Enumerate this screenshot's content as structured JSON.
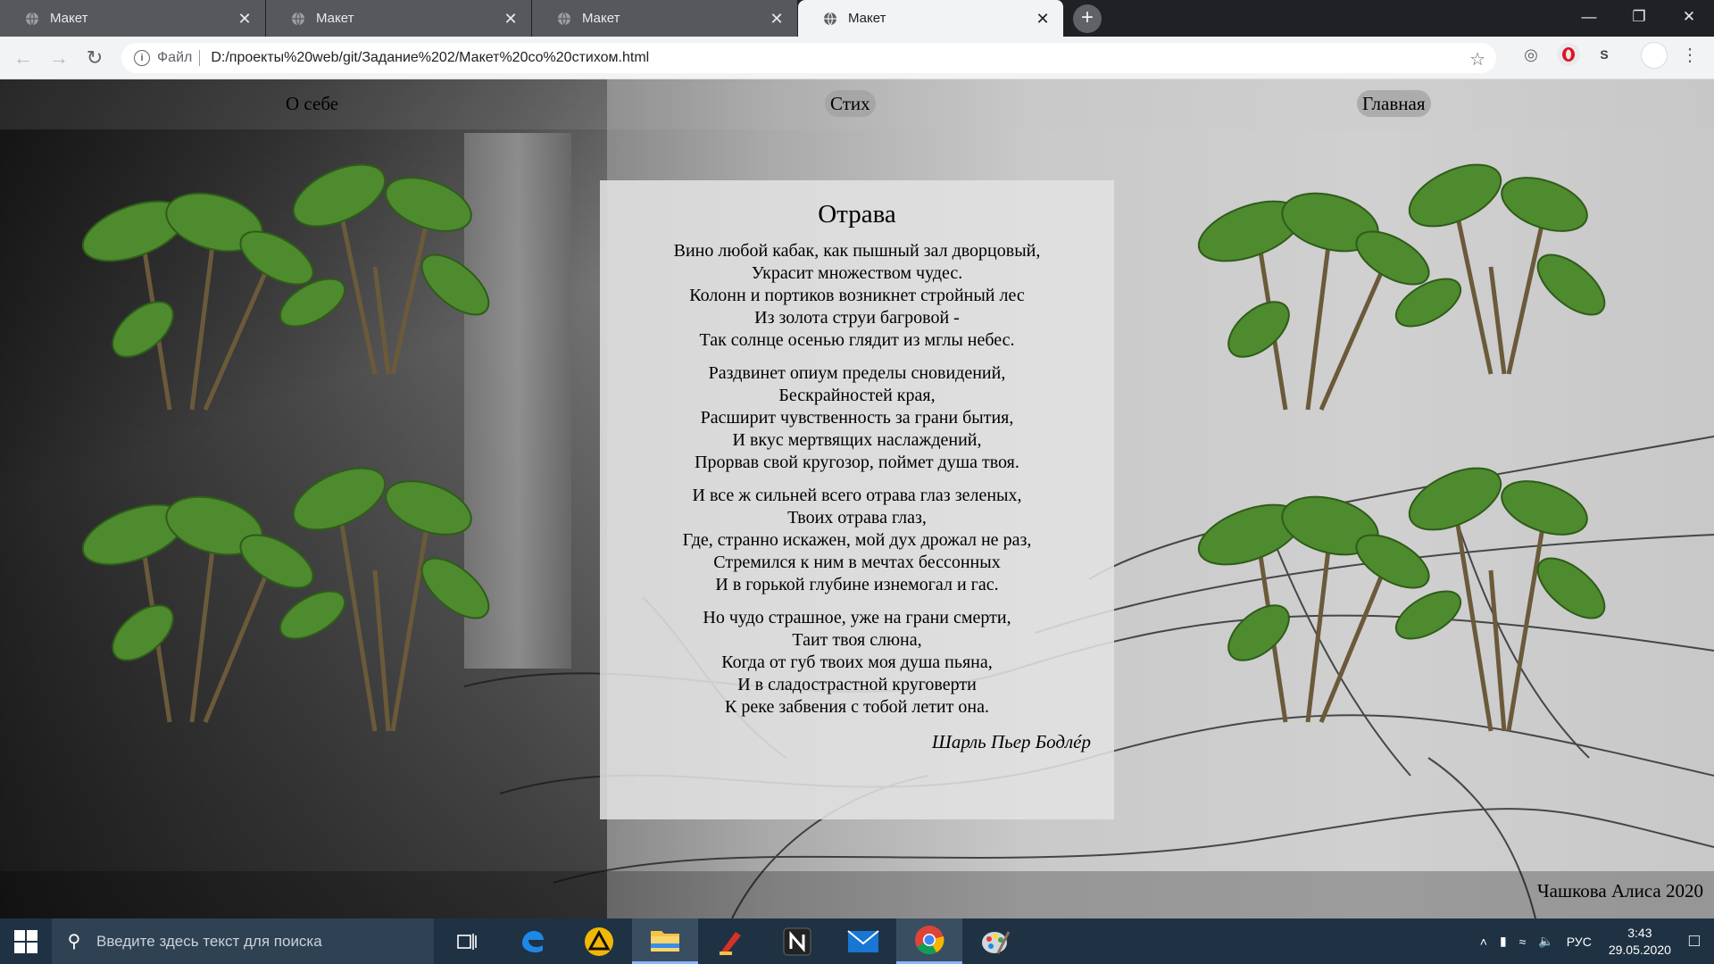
{
  "browser": {
    "tabs": [
      {
        "title": "Макет",
        "active": false
      },
      {
        "title": "Макет",
        "active": false
      },
      {
        "title": "Макет",
        "active": false
      },
      {
        "title": "Макет",
        "active": true
      }
    ],
    "close_glyph": "✕",
    "new_tab_glyph": "+",
    "address": {
      "scheme_label": "Файл",
      "url": "D:/проекты%20web/git/Задание%202/Макет%20со%20стихом.html"
    },
    "profile_letter": "S"
  },
  "page": {
    "nav": {
      "about": "О себе",
      "poem": "Стих",
      "home": "Главная"
    },
    "poem": {
      "title": "Отрава",
      "stanzas": [
        [
          "Вино любой кабак, как пышный зал дворцовый,",
          "Украсит множеством чудес.",
          "Колонн и портиков возникнет стройный лес",
          "Из золота струи багровой -",
          "Так солнце осенью глядит из мглы небес."
        ],
        [
          "Раздвинет опиум пределы сновидений,",
          "Бескрайностей края,",
          "Расширит чувственность за грани бытия,",
          "И вкус мертвящих наслаждений,",
          "Прорвав свой кругозор, поймет душа твоя."
        ],
        [
          "И все ж сильней всего отрава глаз зеленых,",
          "Твоих отрава глаз,",
          "Где, странно искажен, мой дух дрожал не раз,",
          "Стремился к ним в мечтах бессонных",
          "И в горькой глубине изнемогал и гас."
        ],
        [
          "Но чудо страшное, уже на грани смерти,",
          "Таит твоя слюна,",
          "Когда от губ твоих моя душа пьяна,",
          "И в сладострастной круговерти",
          "К реке забвения с тобой летит она."
        ]
      ],
      "author": "Шарль Пьер Бодлéр"
    },
    "footer": "Чашкова Алиса 2020"
  },
  "taskbar": {
    "search_placeholder": "Введите здесь текст для поиска",
    "language": "РУС",
    "time": "3:43",
    "date": "29.05.2020"
  },
  "colors": {
    "accent_blue": "#8ab4f8",
    "plant_green": "#4e8a2e"
  }
}
